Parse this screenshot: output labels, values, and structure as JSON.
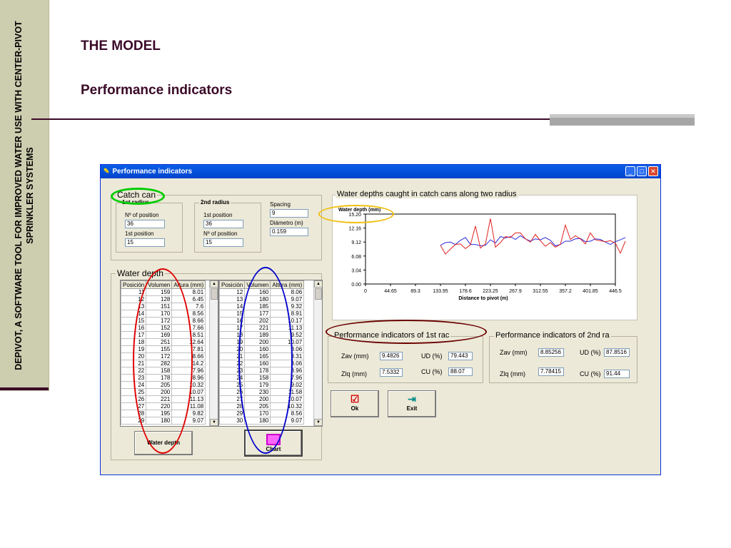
{
  "slide": {
    "sidebar_text": "DEPIVOT, A SOFTWARE TOOL FOR IMPROVED WATER USE WITH CENTER-PIVOT SPRINKLER SYSTEMS",
    "title": "THE MODEL",
    "subtitle": "Performance indicators"
  },
  "window": {
    "title": "Performance indicators",
    "buttons": {
      "minimize": "_",
      "maximize": "□",
      "close": "✕"
    }
  },
  "catch_cans": {
    "legend": "Catch can",
    "first_radius": {
      "heading": "1st radius",
      "n_position_label": "Nº of position",
      "n_position_value": "36",
      "first_position_label": "1st position",
      "first_position_value": "15"
    },
    "second_radius": {
      "heading": "2nd radius",
      "first_position_label": "1st position",
      "first_position_value": "36",
      "n_position_label": "Nº of position",
      "n_position_value": "15"
    },
    "spacing_label": "Spacing",
    "spacing_value": "9",
    "diameter_label": "Diámetro  (m)",
    "diameter_value": "0.159"
  },
  "water_depth": {
    "legend": "Water depth",
    "columns": [
      "Posición",
      "Volumen",
      "Altura (mm)"
    ],
    "table1": [
      [
        "11",
        "159",
        "8.01"
      ],
      [
        "12",
        "128",
        "6.45"
      ],
      [
        "13",
        "151",
        "7.6"
      ],
      [
        "14",
        "170",
        "8.56"
      ],
      [
        "15",
        "172",
        "8.66"
      ],
      [
        "16",
        "152",
        "7.66"
      ],
      [
        "17",
        "169",
        "8.51"
      ],
      [
        "18",
        "251",
        "12.64"
      ],
      [
        "19",
        "155",
        "7.81"
      ],
      [
        "20",
        "172",
        "8.66"
      ],
      [
        "21",
        "282",
        "14.2"
      ],
      [
        "22",
        "158",
        "7.96"
      ],
      [
        "23",
        "178",
        "8.96"
      ],
      [
        "24",
        "205",
        "10.32"
      ],
      [
        "25",
        "200",
        "10.07"
      ],
      [
        "26",
        "221",
        "11.13"
      ],
      [
        "27",
        "220",
        "11.08"
      ],
      [
        "28",
        "195",
        "9.82"
      ],
      [
        "29",
        "180",
        "9.07"
      ]
    ],
    "table2": [
      [
        "12",
        "160",
        "8.06"
      ],
      [
        "13",
        "180",
        "9.07"
      ],
      [
        "14",
        "185",
        "9.32"
      ],
      [
        "15",
        "177",
        "8.91"
      ],
      [
        "16",
        "202",
        "10.17"
      ],
      [
        "17",
        "221",
        "11.13"
      ],
      [
        "18",
        "189",
        "9.52"
      ],
      [
        "19",
        "200",
        "10.07"
      ],
      [
        "20",
        "160",
        "8.06"
      ],
      [
        "21",
        "165",
        "8.31"
      ],
      [
        "22",
        "160",
        "8.06"
      ],
      [
        "23",
        "178",
        "8.96"
      ],
      [
        "24",
        "158",
        "7.96"
      ],
      [
        "25",
        "179",
        "9.02"
      ],
      [
        "26",
        "230",
        "11.58"
      ],
      [
        "27",
        "200",
        "10.07"
      ],
      [
        "28",
        "205",
        "10.32"
      ],
      [
        "29",
        "170",
        "8.56"
      ],
      [
        "30",
        "180",
        "9.07"
      ]
    ],
    "water_depth_button": "Water depth",
    "chart_button": "Chart"
  },
  "chart_panel": {
    "legend": "Water depths caught in catch cans along two radius"
  },
  "chart_data": {
    "type": "line",
    "title": "",
    "ylabel": "Water depth (mm)",
    "xlabel": "Distance to pivot (m)",
    "ylim": [
      0,
      15.2
    ],
    "xlim": [
      0,
      446.5
    ],
    "y_ticks": [
      "15.20",
      "12.16",
      "9.12",
      "6.08",
      "3.04",
      "0.00"
    ],
    "x_ticks": [
      "0",
      "44.65",
      "89.3",
      "133.95",
      "178.6",
      "223.25",
      "267.9",
      "312.55",
      "357.2",
      "401.85",
      "446.5"
    ],
    "x_start": 133.95,
    "x_step": 8.93,
    "series": [
      {
        "color": "#2a2ae0",
        "values": [
          8.4,
          9.0,
          9.1,
          8.6,
          9.5,
          10.1,
          8.6,
          8.6,
          8.3,
          8.4,
          9.6,
          8.9,
          10.3,
          10.0,
          10.3,
          9.7,
          10.5,
          9.8,
          9.3,
          9.8,
          9.6,
          10.1,
          9.5,
          8.3,
          8.6,
          9.3,
          9.3,
          9.8,
          9.9,
          9.2,
          9.3,
          9.8,
          9.7,
          9.1,
          8.6,
          9.2,
          9.6,
          10.1
        ]
      },
      {
        "color": "#e02020",
        "values": [
          8.4,
          6.5,
          7.6,
          8.6,
          8.7,
          7.7,
          8.5,
          12.6,
          7.8,
          8.7,
          14.2,
          8.0,
          9.0,
          10.3,
          10.1,
          11.1,
          11.1,
          9.8,
          9.1,
          10.8,
          9.4,
          8.2,
          9.0,
          8.0,
          8.6,
          12.8,
          9.7,
          10.5,
          9.8,
          8.7,
          11.1,
          9.6,
          9.4,
          9.2,
          9.4,
          8.9,
          6.7,
          9.3
        ]
      }
    ]
  },
  "performance_1st": {
    "legend": "Performance indicators of 1st rac",
    "zav_label": "Zav (mm)",
    "zav_value": "9.4826",
    "ud_label": "UD (%)",
    "ud_value": "79.443",
    "zlq_label": "Zlq (mm)",
    "zlq_value": "7.5332",
    "cu_label": "CU (%)",
    "cu_value": "88.07"
  },
  "performance_2nd": {
    "legend": "Performance indicators of 2nd ra",
    "zav_label": "Zav (mm)",
    "zav_value": "8.85256",
    "ud_label": "UD (%)",
    "ud_value": "87.8516",
    "zlq_label": "Zlq (mm)",
    "zlq_value": "7.78415",
    "cu_label": "CU (%)",
    "cu_value": "91.44"
  },
  "actions": {
    "ok_label": "Ok",
    "exit_label": "Exit"
  },
  "annotation_colors": {
    "green": "#00cc00",
    "yellow": "#f0c010",
    "maroon": "#6a0000",
    "red": "#e00000",
    "blue": "#0000cc"
  }
}
